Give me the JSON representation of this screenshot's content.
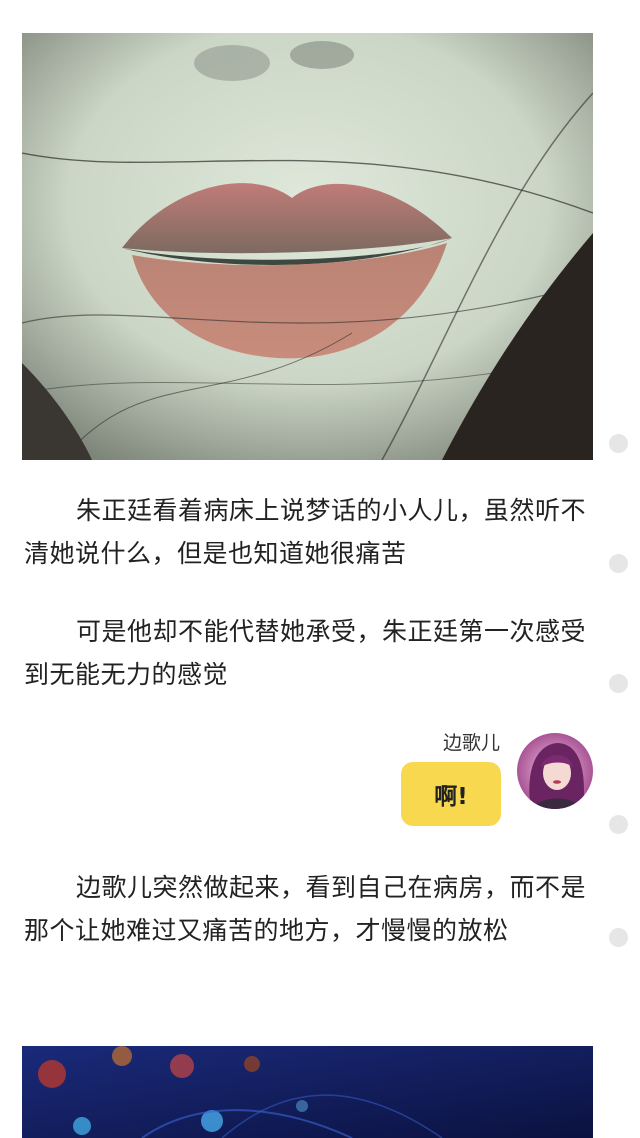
{
  "article": {
    "paragraphs": [
      "朱正廷看着病床上说梦话的小人儿，虽然听不清她说什么，但是也知道她很痛苦",
      "可是他却不能代替她承受，朱正廷第一次感受到无能无力的感觉",
      "边歌儿突然做起来，看到自己在病房，而不是那个让她难过又痛苦的地方，才慢慢的放松"
    ]
  },
  "chat": {
    "speaker": "边歌儿",
    "message": "啊!",
    "bubble_color": "#f8d84e"
  },
  "images": {
    "top_photo": "close-up-lips-photo",
    "bottom_photo": "dark-blue-bokeh-photo",
    "avatar": "girl-purple-hair-avatar"
  },
  "colors": {
    "text": "#222222",
    "scroll_dot": "#e6e6e6"
  }
}
